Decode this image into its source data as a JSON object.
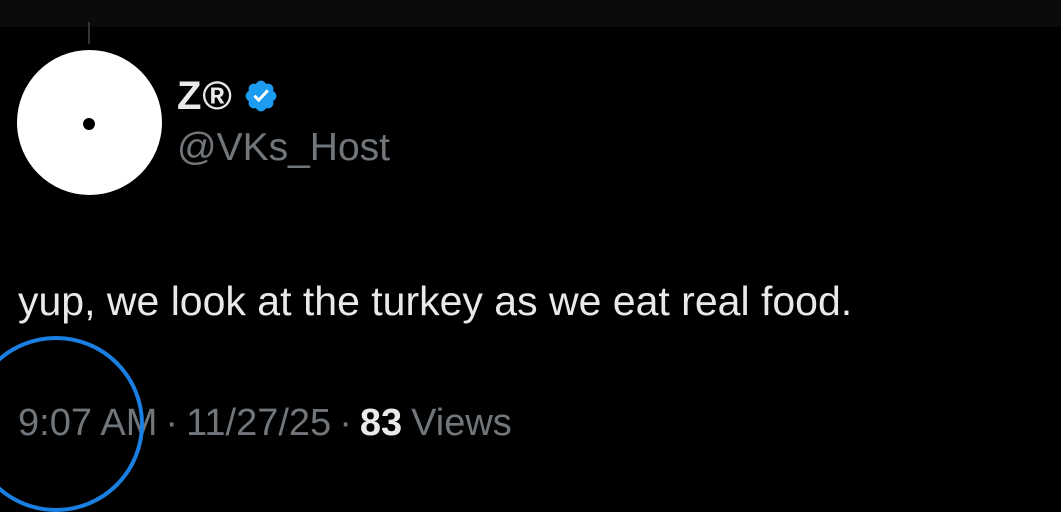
{
  "author": {
    "display_name": "Z®",
    "handle": "@VKs_Host",
    "verified_icon": "verified-badge-icon",
    "avatar_icon": "avatar-dot-icon"
  },
  "tweet": {
    "text": "yup, we look at the turkey as we eat real food."
  },
  "meta": {
    "time": "9:07 AM",
    "separator": "·",
    "date": "11/27/25",
    "views_count": "83",
    "views_label": "Views"
  },
  "colors": {
    "background": "#000000",
    "primary_text": "#e7e9ea",
    "secondary_text": "#71767b",
    "verified_blue": "#1d9bf0",
    "annotation_circle": "#1a7fe0"
  }
}
